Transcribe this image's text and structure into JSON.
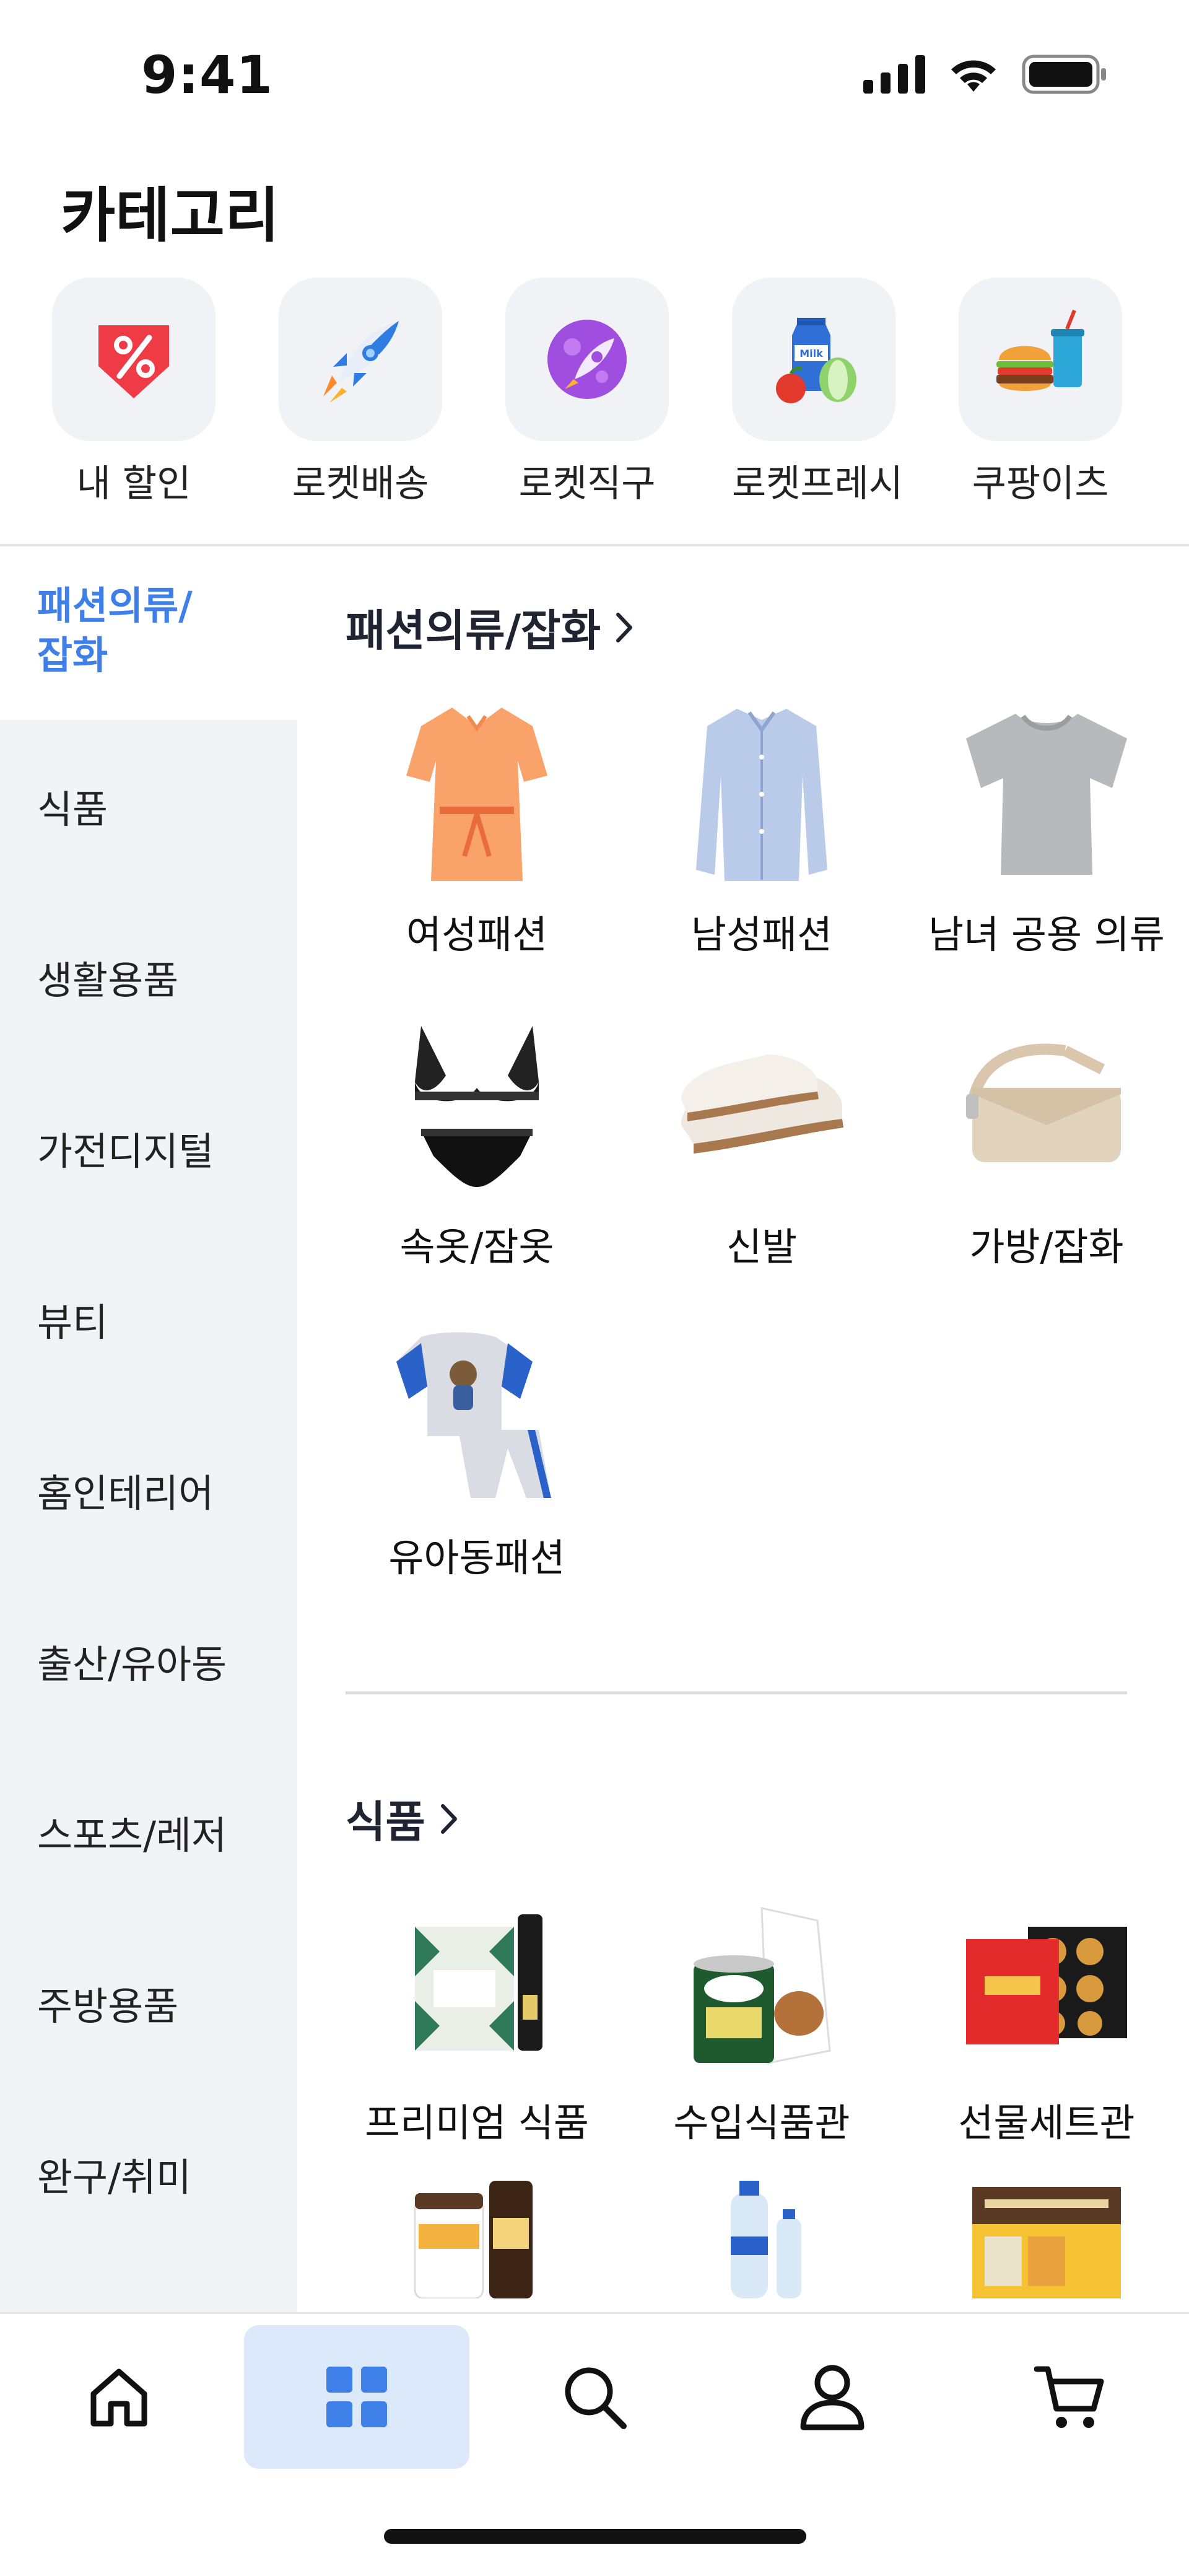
{
  "status": {
    "time": "9:41"
  },
  "page": {
    "title": "카테고리"
  },
  "quick_links": [
    {
      "label": "내 할인",
      "icon": "discount-tag-icon"
    },
    {
      "label": "로켓배송",
      "icon": "rocket-icon"
    },
    {
      "label": "로켓직구",
      "icon": "rocket-planet-icon"
    },
    {
      "label": "로켓프레시",
      "icon": "fresh-food-icon"
    },
    {
      "label": "쿠팡이츠",
      "icon": "burger-icon"
    }
  ],
  "sidebar": {
    "active_label_line1": "패션의류/",
    "active_label_line2": "잡화",
    "items": [
      "식품",
      "생활용품",
      "가전디지털",
      "뷰티",
      "홈인테리어",
      "출산/유아동",
      "스포츠/레저",
      "주방용품",
      "완구/취미"
    ]
  },
  "sections": [
    {
      "title": "패션의류/잡화",
      "items": [
        "여성패션",
        "남성패션",
        "남녀 공용 의류",
        "속옷/잠옷",
        "신발",
        "가방/잡화",
        "유아동패션"
      ]
    },
    {
      "title": "식품",
      "items": [
        "프리미엄 식품",
        "수입식품관",
        "선물세트관"
      ]
    }
  ],
  "bottom_nav": [
    "home-icon",
    "category-grid-icon",
    "search-icon",
    "profile-icon",
    "cart-icon"
  ],
  "colors": {
    "accent": "#3f7fe8",
    "active_nav_bg": "#dbe9fb",
    "sidebar_bg": "#f2f3f6"
  }
}
